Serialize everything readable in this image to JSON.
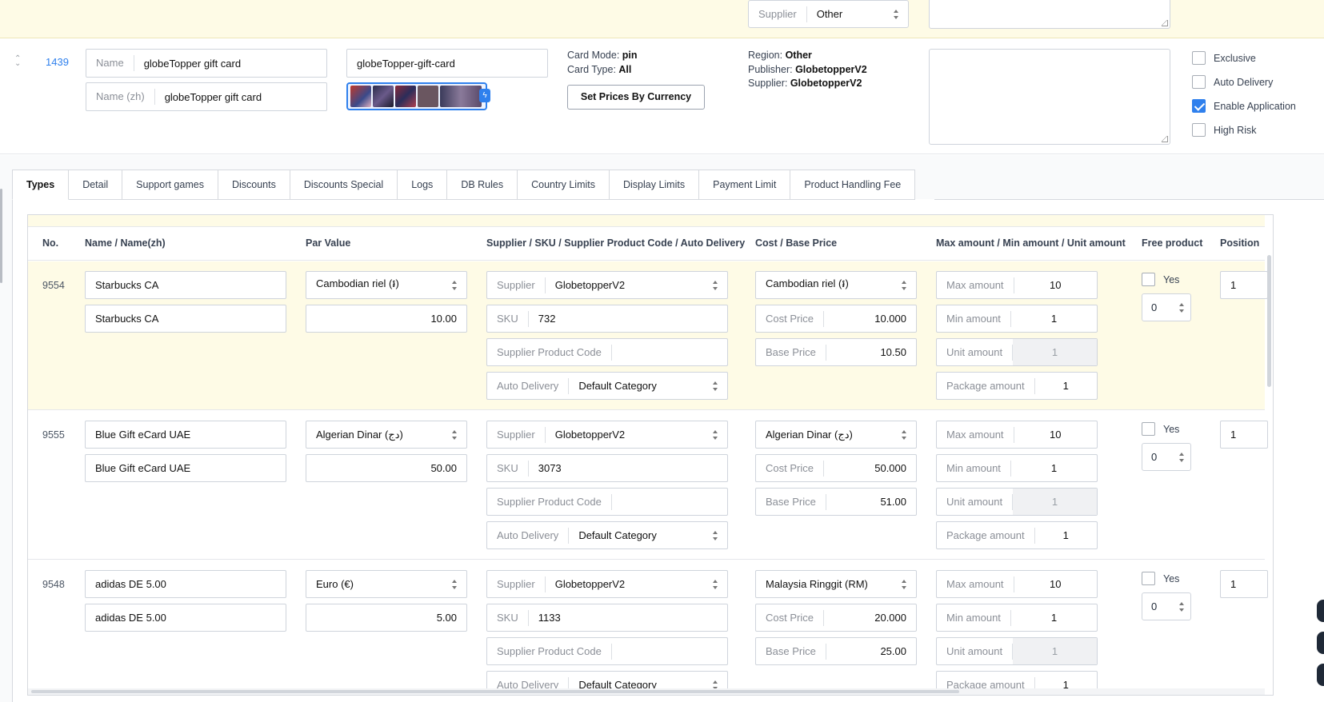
{
  "top_strip": {
    "supplier_label": "Supplier",
    "supplier_value": "Other"
  },
  "product": {
    "id": "1439",
    "name_label": "Name",
    "name_value": "globeTopper gift card",
    "name_zh_label": "Name (zh)",
    "name_zh_value": "globeTopper gift card",
    "slug": "globeTopper-gift-card",
    "card_mode_label": "Card Mode:",
    "card_mode_value": "pin",
    "card_type_label": "Card Type:",
    "card_type_value": "All",
    "set_prices_button": "Set Prices By Currency",
    "region_label": "Region:",
    "region_value": "Other",
    "publisher_label": "Publisher:",
    "publisher_value": "GlobetopperV2",
    "supplier_label": "Supplier:",
    "supplier_value": "GlobetopperV2",
    "checkboxes": [
      {
        "label": "Exclusive",
        "checked": false
      },
      {
        "label": "Auto Delivery",
        "checked": false
      },
      {
        "label": "Enable Application",
        "checked": true
      },
      {
        "label": "High Risk",
        "checked": false
      }
    ]
  },
  "tabs": [
    "Types",
    "Detail",
    "Support games",
    "Discounts",
    "Discounts Special",
    "Logs",
    "DB Rules",
    "Country Limits",
    "Display Limits",
    "Payment Limit",
    "Product Handling Fee"
  ],
  "table": {
    "headers": {
      "no": "No.",
      "name": "Name / Name(zh)",
      "par_value": "Par Value",
      "supplier": "Supplier / SKU / Supplier Product Code / Auto Delivery",
      "cost": "Cost / Base Price",
      "amounts": "Max amount / Min amount / Unit amount",
      "free": "Free product",
      "position": "Position"
    },
    "field_labels": {
      "supplier": "Supplier",
      "sku": "SKU",
      "supplier_product_code": "Supplier Product Code",
      "auto_delivery": "Auto Delivery",
      "cost_price": "Cost Price",
      "base_price": "Base Price",
      "max_amount": "Max amount",
      "min_amount": "Min amount",
      "unit_amount": "Unit amount",
      "package_amount": "Package amount",
      "yes": "Yes"
    },
    "rows": [
      {
        "no": "9554",
        "name": "Starbucks CA",
        "name_zh": "Starbucks CA",
        "par_currency": "Cambodian riel (៛)",
        "par_value": "10.00",
        "supplier": "GlobetopperV2",
        "sku": "732",
        "supplier_product_code": "",
        "auto_delivery": "Default Category",
        "cost_currency": "Cambodian riel (៛)",
        "cost_price": "10.000",
        "base_price": "10.50",
        "max_amount": "10",
        "min_amount": "1",
        "unit_amount": "1",
        "package_amount": "1",
        "free_count": "0",
        "position": "1"
      },
      {
        "no": "9555",
        "name": "Blue Gift eCard UAE",
        "name_zh": "Blue Gift eCard UAE",
        "par_currency": "Algerian Dinar (دج)",
        "par_value": "50.00",
        "supplier": "GlobetopperV2",
        "sku": "3073",
        "supplier_product_code": "",
        "auto_delivery": "Default Category",
        "cost_currency": "Algerian Dinar (دج)",
        "cost_price": "50.000",
        "base_price": "51.00",
        "max_amount": "10",
        "min_amount": "1",
        "unit_amount": "1",
        "package_amount": "1",
        "free_count": "0",
        "position": "1"
      },
      {
        "no": "9548",
        "name": "adidas DE 5.00",
        "name_zh": "adidas DE 5.00",
        "par_currency": "Euro (€)",
        "par_value": "5.00",
        "supplier": "GlobetopperV2",
        "sku": "1133",
        "supplier_product_code": "",
        "auto_delivery": "Default Category",
        "cost_currency": "Malaysia Ringgit (RM)",
        "cost_price": "20.000",
        "base_price": "25.00",
        "max_amount": "10",
        "min_amount": "1",
        "unit_amount": "1",
        "package_amount": "1",
        "free_count": "0",
        "position": "1"
      }
    ]
  }
}
